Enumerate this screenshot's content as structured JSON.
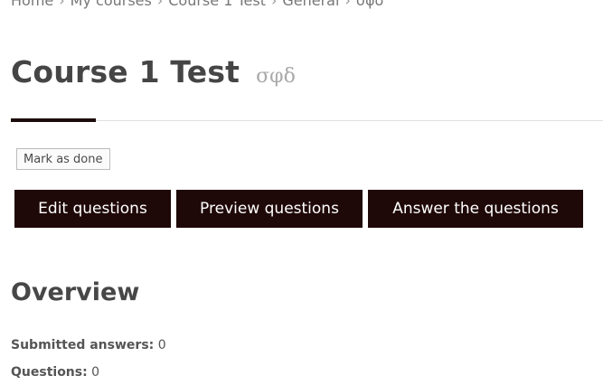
{
  "breadcrumb": [
    "Home",
    "My courses",
    "Course 1 Test",
    "General",
    "σφδ"
  ],
  "page": {
    "title": "Course 1 Test",
    "subtitle": "σφδ"
  },
  "actions": {
    "mark_done": "Mark as done",
    "edit": "Edit questions",
    "preview": "Preview questions",
    "answer": "Answer the questions"
  },
  "overview": {
    "heading": "Overview",
    "submitted_label": "Submitted answers:",
    "submitted_value": "0",
    "questions_label": "Questions:",
    "questions_value": "0"
  },
  "colors": {
    "button_bg": "#1f0808",
    "accent_bar": "#1d0c0c"
  }
}
